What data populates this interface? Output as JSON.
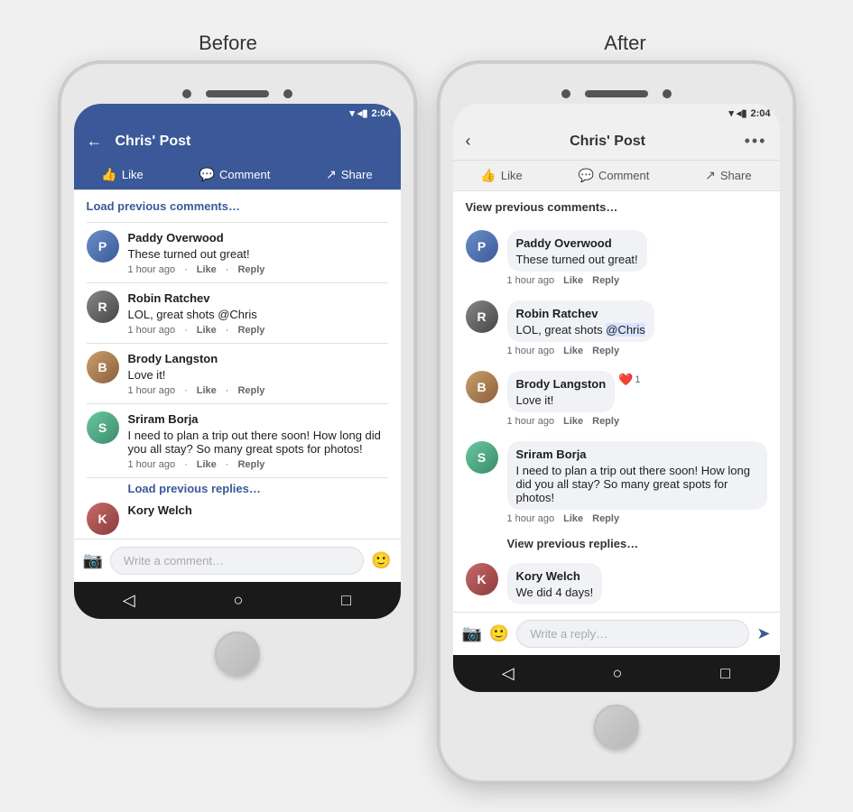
{
  "labels": {
    "before": "Before",
    "after": "After"
  },
  "statusBar": {
    "time": "2:04",
    "icons": "▾◂▮"
  },
  "before": {
    "header": {
      "back": "←",
      "title": "Chris' Post"
    },
    "actionBar": {
      "like": "Like",
      "comment": "Comment",
      "share": "Share"
    },
    "loadPrevious": "Load previous comments…",
    "comments": [
      {
        "name": "Paddy Overwood",
        "text": "These turned out great!",
        "time": "1 hour ago",
        "like": "Like",
        "reply": "Reply",
        "avatar": "P",
        "avatarClass": "avatar-paddy"
      },
      {
        "name": "Robin Ratchev",
        "text": "LOL, great shots @Chris",
        "time": "1 hour ago",
        "like": "Like",
        "reply": "Reply",
        "avatar": "R",
        "avatarClass": "avatar-robin"
      },
      {
        "name": "Brody Langston",
        "text": "Love it!",
        "time": "1 hour ago",
        "like": "Like",
        "reply": "Reply",
        "avatar": "B",
        "avatarClass": "avatar-brody"
      },
      {
        "name": "Sriram Borja",
        "text": "I need to plan a trip out there soon! How long did you all stay? So many great spots for photos!",
        "time": "1 hour ago",
        "like": "Like",
        "reply": "Reply",
        "avatar": "S",
        "avatarClass": "avatar-sriram"
      }
    ],
    "loadReplies": "Load previous replies…",
    "koryName": "Kory Welch",
    "inputPlaceholder": "Write a comment…"
  },
  "after": {
    "header": {
      "back": "‹",
      "title": "Chris' Post",
      "more": "•••"
    },
    "actionBar": {
      "like": "Like",
      "comment": "Comment",
      "share": "Share"
    },
    "loadPrevious": "View previous comments…",
    "comments": [
      {
        "name": "Paddy Overwood",
        "text": "These turned out great!",
        "time": "1 hour ago",
        "like": "Like",
        "reply": "Reply",
        "avatar": "P",
        "avatarClass": "avatar-paddy"
      },
      {
        "name": "Robin Ratchev",
        "text": "LOL, great shots @Chris",
        "time": "1 hour ago",
        "like": "Like",
        "reply": "Reply",
        "avatar": "R",
        "avatarClass": "avatar-robin"
      },
      {
        "name": "Brody Langston",
        "text": "Love it!",
        "time": "1 hour ago",
        "like": "Like",
        "reply": "Reply",
        "reactionCount": "1",
        "avatar": "B",
        "avatarClass": "avatar-brody"
      },
      {
        "name": "Sriram Borja",
        "text": "I need to plan a trip out there soon! How long did you all stay? So many great spots for photos!",
        "time": "1 hour ago",
        "like": "Like",
        "reply": "Reply",
        "avatar": "S",
        "avatarClass": "avatar-sriram"
      }
    ],
    "viewReplies": "View previous replies…",
    "koryName": "Kory Welch",
    "koryText": "We did 4 days!",
    "inputPlaceholder": "Write a reply…"
  },
  "navIcons": {
    "back": "◁",
    "home": "○",
    "square": "□"
  }
}
